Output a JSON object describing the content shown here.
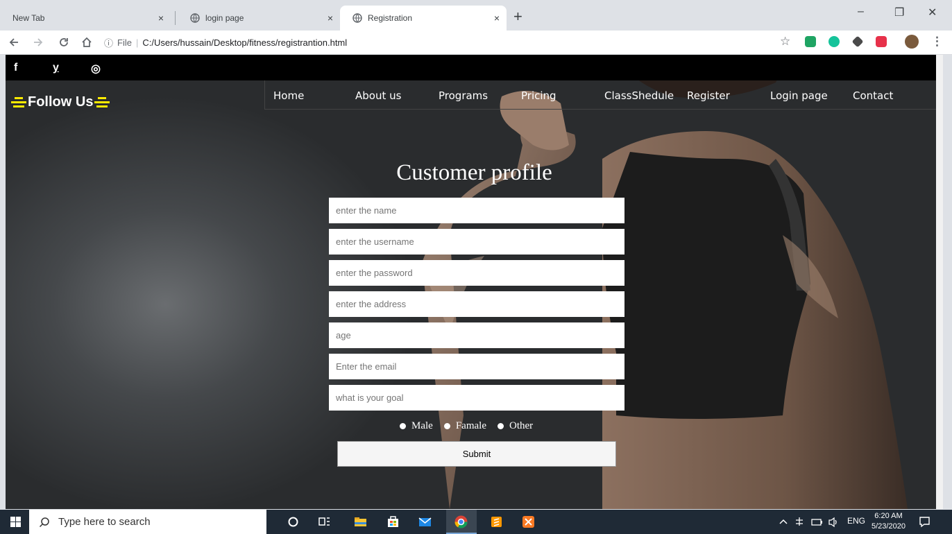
{
  "browser": {
    "tabs": [
      {
        "label": "New Tab"
      },
      {
        "label": "login page"
      },
      {
        "label": "Registration"
      }
    ],
    "close_glyph": "×",
    "new_tab_glyph": "+",
    "address": {
      "info_glyph": "ⓘ",
      "scheme_label": "File",
      "separator": "|",
      "url": "C:/Users/hussain/Desktop/fitness/registrantion.html"
    },
    "star_glyph": "☆",
    "menu_glyph": "⋮",
    "window_controls": {
      "minimize": "–",
      "restore": "❐",
      "close": "✕"
    }
  },
  "site": {
    "social": {
      "facebook": "f",
      "twitter": "y",
      "instagram": "◎"
    },
    "follow_us": "Follow Us",
    "nav": [
      "Home",
      "About us",
      "Programs",
      "Pricing",
      "ClassShedule",
      "Register",
      "Login page",
      "Contact"
    ],
    "form": {
      "title": "Customer profile",
      "fields": [
        {
          "placeholder": "enter the name"
        },
        {
          "placeholder": "enter the username"
        },
        {
          "placeholder": "enter the password"
        },
        {
          "placeholder": "enter the address"
        },
        {
          "placeholder": "age"
        },
        {
          "placeholder": "Enter the email"
        },
        {
          "placeholder": "what is your goal"
        }
      ],
      "genders": [
        "Male",
        "Famale",
        "Other"
      ],
      "submit": "Submit"
    },
    "accent_color": "#ffeb00"
  },
  "taskbar": {
    "search_placeholder": "Type here to search",
    "language": "ENG",
    "time": "6:20 AM",
    "date": "5/23/2020"
  }
}
